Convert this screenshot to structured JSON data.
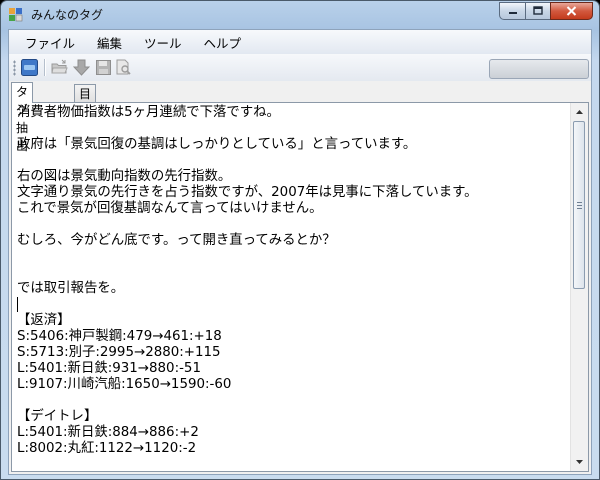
{
  "window": {
    "title": "みんなのタグ",
    "controls": {
      "minimize": "minimize",
      "maximize": "maximize",
      "close": "close"
    }
  },
  "menu": {
    "items": [
      {
        "label": "ファイル"
      },
      {
        "label": "編集"
      },
      {
        "label": "ツール"
      },
      {
        "label": "ヘルプ"
      }
    ]
  },
  "toolbar": {
    "icons": [
      "app-tool-icon",
      "open-folder-icon",
      "download-arrow-icon",
      "save-disk-icon",
      "preview-icon"
    ]
  },
  "tabs": [
    {
      "label": "タグ抽出",
      "active": true
    },
    {
      "label": "目次作成",
      "active": false
    }
  ],
  "editor": {
    "lines": [
      "消費者物価指数は5ヶ月連続で下落ですね。",
      "",
      "政府は「景気回復の基調はしっかりとしている」と言っています。",
      "",
      "右の図は景気動向指数の先行指数。",
      "文字通り景気の先行きを占う指数ですが、2007年は見事に下落しています。",
      "これで景気が回復基調なんて言ってはいけません。",
      "",
      "むしろ、今がどん底です。って開き直ってみるとか？",
      "",
      "",
      "では取引報告を。",
      "",
      "【返済】",
      "S:5406:神戸製鋼:479→461:+18",
      "S:5713:別子:2995→2880:+115",
      "L:5401:新日鉄:931→880:-51",
      "L:9107:川崎汽船:1650→1590:-60",
      "",
      "【デイトレ】",
      "L:5401:新日鉄:884→886:+2",
      "L:8002:丸紅:1122→1120:-2"
    ],
    "caret_line": 12
  }
}
